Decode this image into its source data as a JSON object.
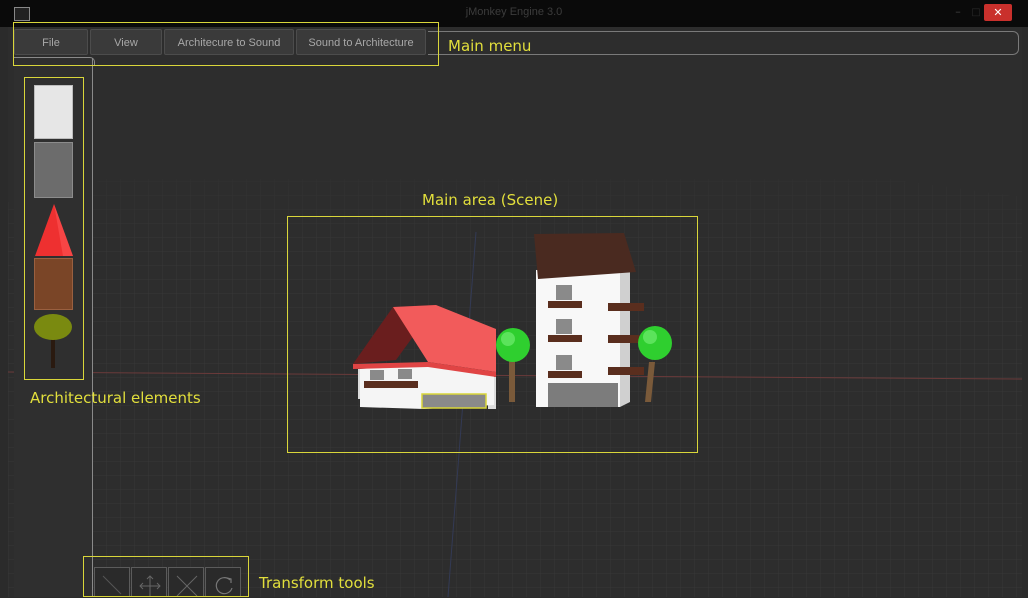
{
  "window": {
    "title": "jMonkey Engine 3.0",
    "minimize_glyph": "–",
    "maximize_glyph": "□",
    "close_glyph": "✕"
  },
  "menu": {
    "items": [
      {
        "label": "File"
      },
      {
        "label": "View"
      },
      {
        "label": "Architecure to Sound"
      },
      {
        "label": "Sound to Architecture"
      }
    ]
  },
  "annotations": {
    "main_menu": "Main menu",
    "main_area": "Main area (Scene)",
    "architectural_elements": "Architectural elements",
    "transform_tools": "Transform tools"
  },
  "sidebar": {
    "elements": [
      {
        "icon": "white-block-icon"
      },
      {
        "icon": "grey-block-icon"
      },
      {
        "icon": "red-roof-icon"
      },
      {
        "icon": "brown-block-icon"
      },
      {
        "icon": "tree-icon"
      }
    ]
  },
  "tools": [
    {
      "icon": "select-icon"
    },
    {
      "icon": "move-icon"
    },
    {
      "icon": "scale-icon"
    },
    {
      "icon": "rotate-icon"
    }
  ],
  "colors": {
    "annotation": "#e2df3c",
    "background": "#2d2d2d",
    "roof": "#f05a5a",
    "tree": "#3fd23f",
    "wood": "#5a2e1e",
    "close_button": "#c9302c"
  }
}
